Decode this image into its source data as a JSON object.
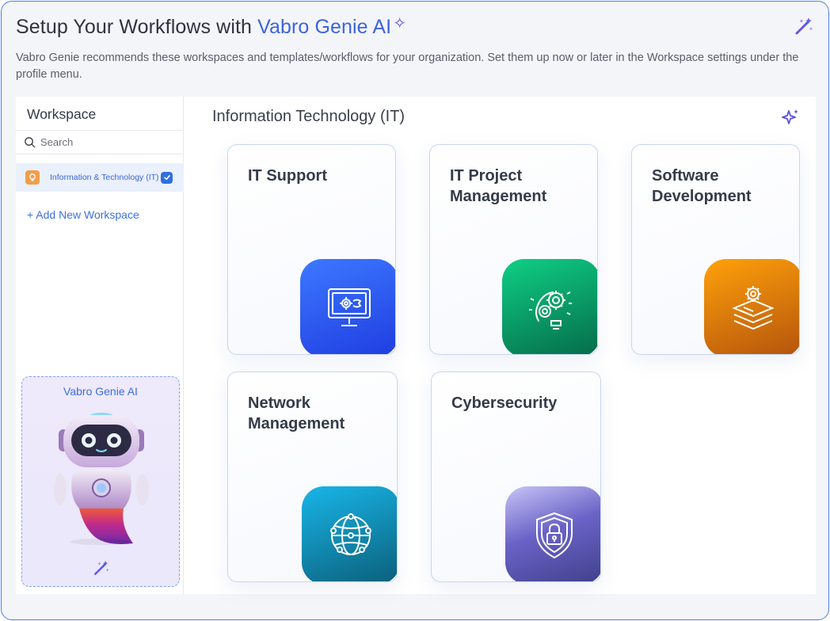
{
  "header": {
    "title_prefix": "Setup Your Workflows with ",
    "title_highlight": "Vabro Genie AI",
    "subtitle": "Vabro Genie recommends these workspaces and templates/workflows for your organization. Set them up now or later in the Workspace settings under the profile menu."
  },
  "sidebar": {
    "title": "Workspace",
    "search_placeholder": "Search",
    "items": [
      {
        "label": "Information & Technology (IT)",
        "checked": true
      }
    ],
    "add_label": "+ Add New Workspace",
    "genie_label": "Vabro Genie AI"
  },
  "main": {
    "title": "Information Technology (IT)",
    "cards": [
      {
        "label": "IT Support",
        "icon": "monitor-gear-icon",
        "color": "#2f5bf0"
      },
      {
        "label": "IT Project Management",
        "icon": "head-gears-icon",
        "color": "#07885c"
      },
      {
        "label": "Software Development",
        "icon": "layers-gear-icon",
        "color": "#e07a0c"
      },
      {
        "label": "Network Management",
        "icon": "globe-network-icon",
        "color": "#1487b5"
      },
      {
        "label": "Cybersecurity",
        "icon": "shield-lock-icon",
        "color": "#6a63c7"
      }
    ]
  },
  "colors": {
    "accent": "#3d63dd",
    "border": "#4a7ee6",
    "sparkle": "#5b4fe0"
  }
}
